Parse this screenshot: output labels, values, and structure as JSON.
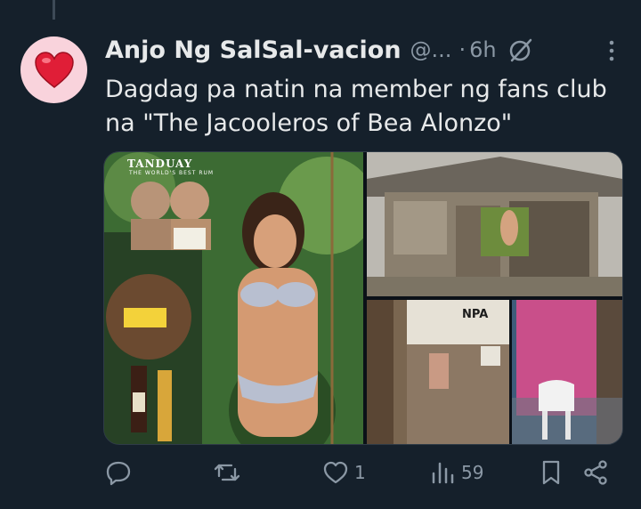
{
  "post": {
    "author_name": "Anjo Ng SalSal-vacion",
    "author_handle": "@...",
    "separator": "·",
    "timestamp": "6h",
    "text": "Dagdag pa natin na member ng fans club na \"The Jacooleros of Bea Alonzo\""
  },
  "media": {
    "brand_text": "TANDUAY",
    "brand_subtext": "THE WORLD'S BEST RUM",
    "sign_text": "NPA"
  },
  "actions": {
    "reply_count": "",
    "repost_count": "",
    "like_count": "1",
    "views_count": "59"
  },
  "colors": {
    "background": "#15202b",
    "muted": "#8b98a5",
    "text": "#e7e9ea",
    "avatar_bg": "#f9d3dc",
    "heart": "#e01e37"
  },
  "icons": [
    "heart-avatar-icon",
    "grok-icon",
    "more-icon",
    "reply-icon",
    "repost-icon",
    "like-icon",
    "views-icon",
    "bookmark-icon",
    "share-icon"
  ]
}
